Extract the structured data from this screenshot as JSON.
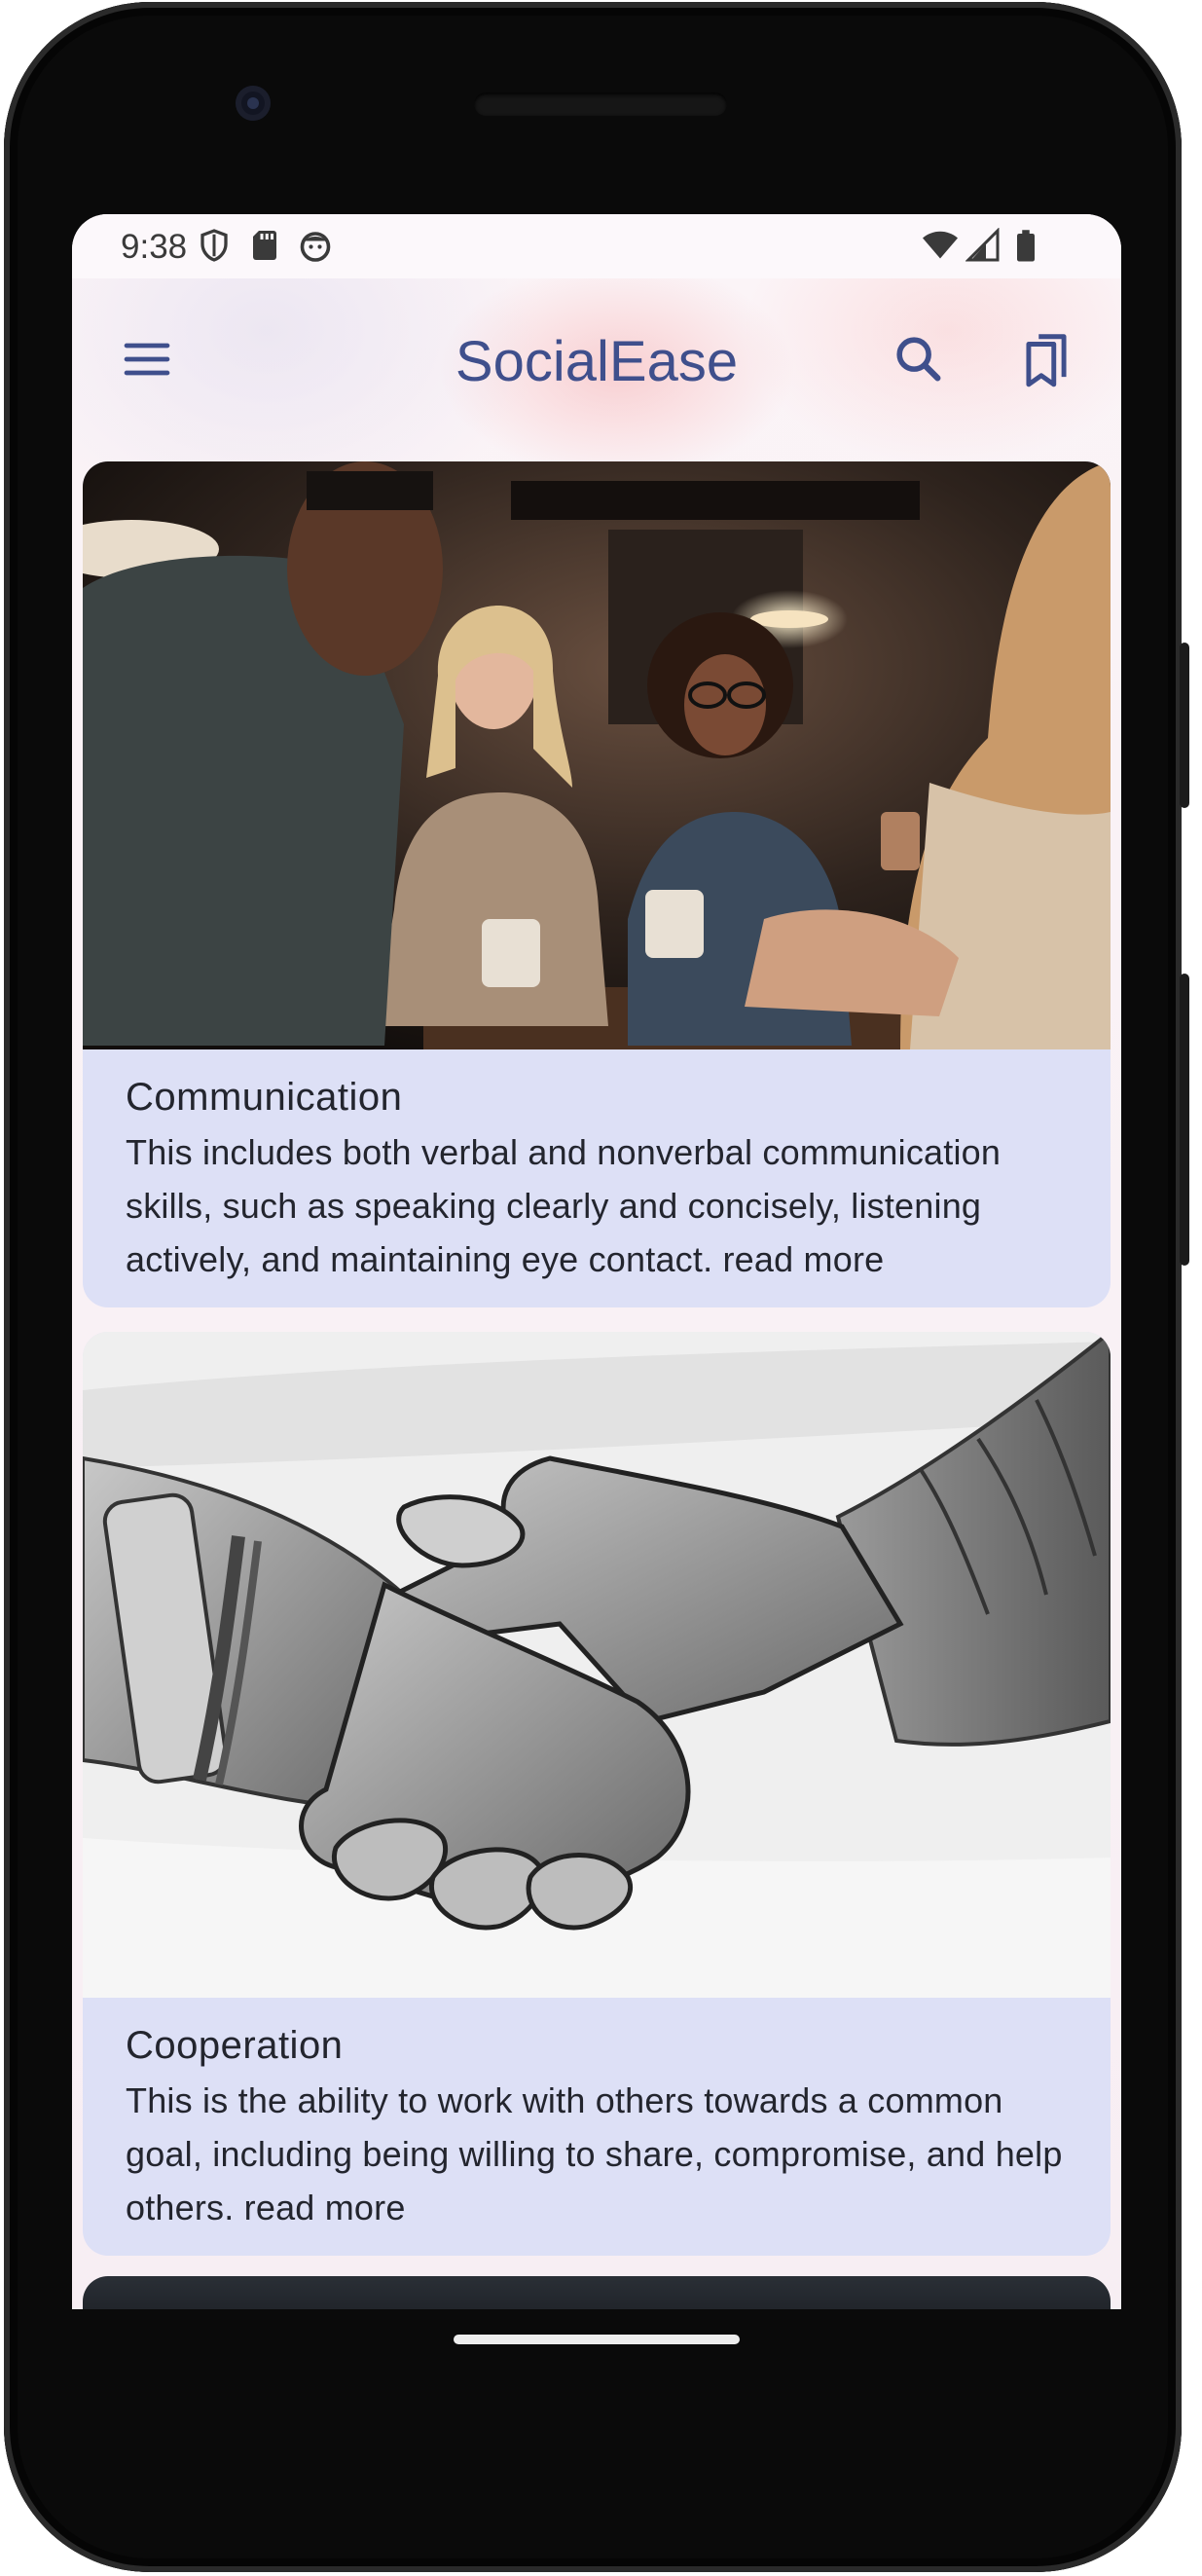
{
  "status_bar": {
    "time": "9:38",
    "left_icons": [
      "shield-icon",
      "sd-card-icon",
      "face-icon"
    ],
    "right_icons": [
      "wifi-icon",
      "signal-icon",
      "battery-icon"
    ]
  },
  "app_bar": {
    "title": "SocialEase",
    "menu_icon": "menu-icon",
    "search_icon": "search-icon",
    "bookmarks_icon": "bookmarks-icon"
  },
  "cards": [
    {
      "title": "Communication",
      "description": "This includes both verbal and nonverbal communication skills, such as speaking clearly and concisely, listening actively, and maintaining eye contact.",
      "read_more": "read more",
      "image": "friends-chatting-in-cafe-photo"
    },
    {
      "title": "Cooperation",
      "description": "This is the ability to work with others towards a common goal, including being willing to share, compromise, and help others.",
      "read_more": "read more",
      "image": "handshake-sketch-illustration"
    }
  ],
  "colors": {
    "title": "#3f4f8c",
    "card_background": "#dde0f6",
    "card_text": "#23252e"
  }
}
